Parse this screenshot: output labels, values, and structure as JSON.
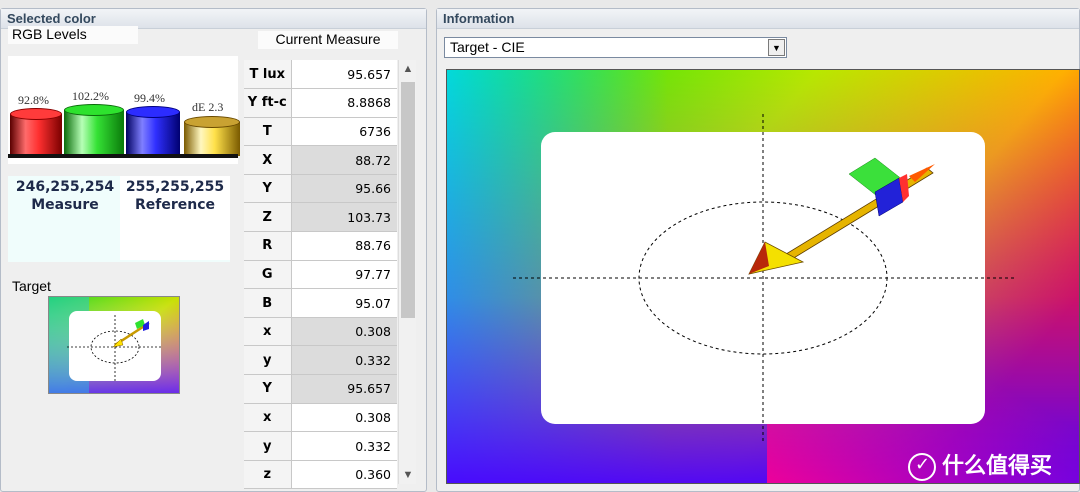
{
  "left": {
    "header": "Selected color",
    "rgb_levels_label": "RGB Levels",
    "bars": [
      {
        "pct": "92.8%",
        "level": 92.8,
        "color": "#e01818"
      },
      {
        "pct": "102.2%",
        "level": 102.2,
        "color": "#1fd21f"
      },
      {
        "pct": "99.4%",
        "level": 99.4,
        "color": "#1a1adb"
      }
    ],
    "de_label": "dE 2.3",
    "measure": {
      "values": "246,255,254",
      "label": "Measure"
    },
    "reference": {
      "values": "255,255,255",
      "label": "Reference"
    },
    "target_label": "Target"
  },
  "current_measure": {
    "title": "Current Measure",
    "rows": [
      {
        "label": "T lux",
        "value": "95.657",
        "shaded": false
      },
      {
        "label": "Y ft-c",
        "value": "8.8868",
        "shaded": false
      },
      {
        "label": "T",
        "value": "6736",
        "shaded": false
      },
      {
        "label": "X",
        "value": "88.72",
        "shaded": true
      },
      {
        "label": "Y",
        "value": "95.66",
        "shaded": true
      },
      {
        "label": "Z",
        "value": "103.73",
        "shaded": true
      },
      {
        "label": "R",
        "value": "88.76",
        "shaded": false
      },
      {
        "label": "G",
        "value": "97.77",
        "shaded": false
      },
      {
        "label": "B",
        "value": "95.07",
        "shaded": false
      },
      {
        "label": "x",
        "value": "0.308",
        "shaded": true
      },
      {
        "label": "y",
        "value": "0.332",
        "shaded": true
      },
      {
        "label": "Y",
        "value": "95.657",
        "shaded": true
      },
      {
        "label": "x",
        "value": "0.308",
        "shaded": false
      },
      {
        "label": "y",
        "value": "0.332",
        "shaded": false
      },
      {
        "label": "z",
        "value": "0.360",
        "shaded": false
      }
    ]
  },
  "right": {
    "header": "Information",
    "dropdown_value": "Target - CIE"
  },
  "watermark": "什么值得买"
}
